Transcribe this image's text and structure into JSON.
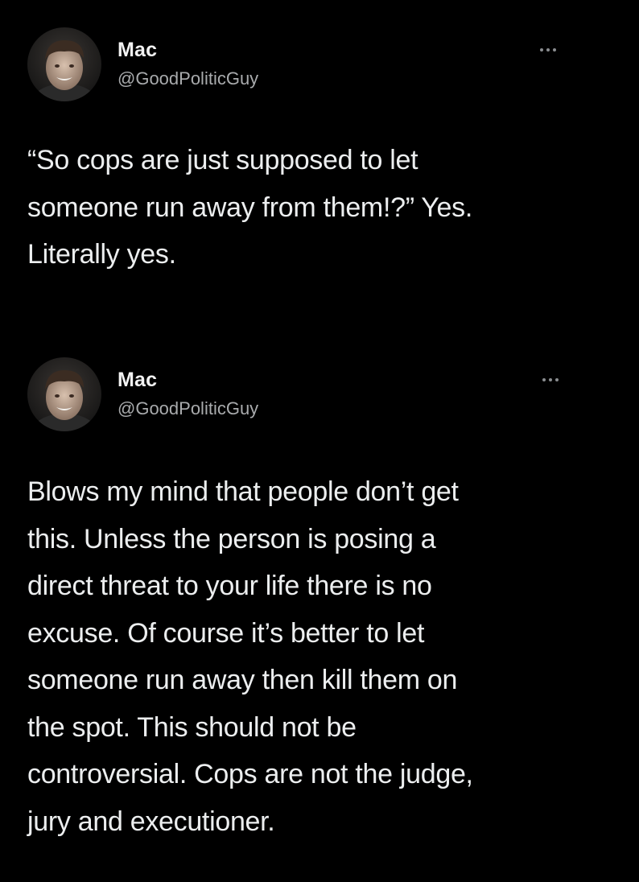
{
  "tweets": [
    {
      "author": {
        "display_name": "Mac",
        "handle": "@GoodPoliticGuy",
        "avatar_icon": "user-avatar-photo"
      },
      "more_icon": "more-options-icon",
      "text": "“So cops are just supposed to let\nsomeone run away from them!?” Yes.\nLiterally yes."
    },
    {
      "author": {
        "display_name": "Mac",
        "handle": "@GoodPoliticGuy",
        "avatar_icon": "user-avatar-photo"
      },
      "more_icon": "more-options-icon",
      "text": "Blows my mind that people don’t get\nthis. Unless the person is posing a\ndirect threat to your life there is no\nexcuse. Of course it’s better to let\nsomeone run away then kill them on\nthe spot. This should not be\ncontroversial. Cops are not the judge,\njury and executioner."
    }
  ],
  "colors": {
    "background": "#000000",
    "text_primary": "#eceeef",
    "text_secondary": "#a9abad"
  }
}
